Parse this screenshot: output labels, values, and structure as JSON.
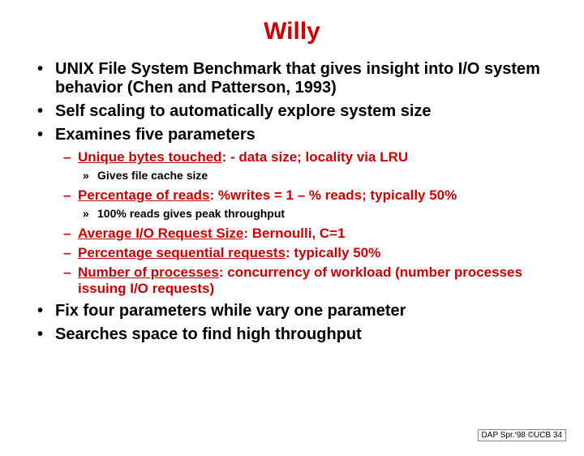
{
  "title": "Willy",
  "bullets": {
    "b1": "UNIX File System Benchmark that gives insight into I/O system behavior (Chen and Patterson, 1993)",
    "b2": "Self scaling to automatically explore system size",
    "b3": "Examines five parameters",
    "b4": "Fix four parameters while vary one parameter",
    "b5": "Searches space to find high throughput"
  },
  "params": {
    "p1_label": "Unique bytes touched",
    "p1_rest": ": - data size; locality via LRU",
    "p1_sub": "Gives file cache size",
    "p2_label": "Percentage of reads",
    "p2_rest": ": %writes = 1 – % reads; typically 50%",
    "p2_sub": "100% reads gives peak throughput",
    "p3_label": "Average I/O Request Size",
    "p3_rest": ": Bernoulli, C=1",
    "p4_label": "Percentage sequential requests",
    "p4_rest": ": typically 50%",
    "p5_label": "Number of processes",
    "p5_rest": ": concurrency of workload (number processes issuing I/O requests)"
  },
  "footer": "DAP Spr.‘98 ©UCB 34"
}
